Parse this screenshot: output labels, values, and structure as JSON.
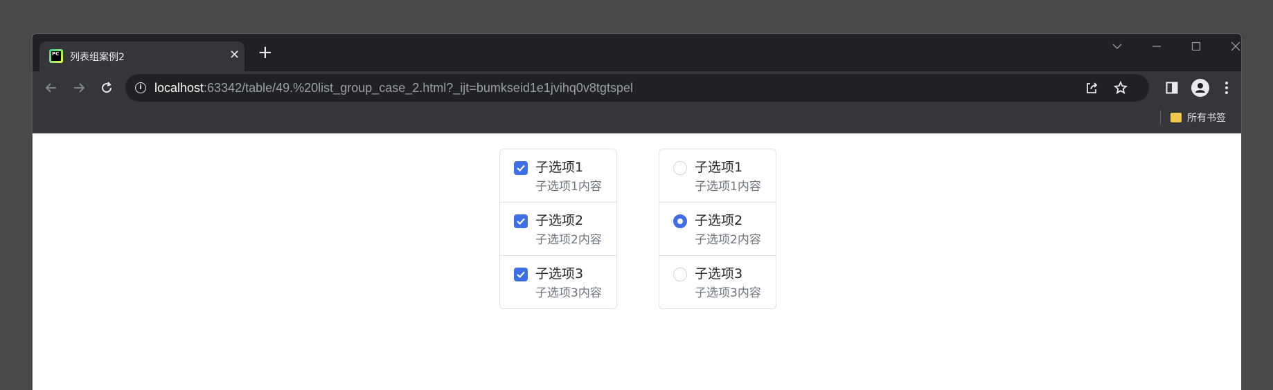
{
  "browser": {
    "tab": {
      "title": "列表组案例2",
      "favicon_text": "PC",
      "close_label": "✕"
    },
    "new_tab_label": "+",
    "url": {
      "host": "localhost",
      "rest": ":63342/table/49.%20list_group_case_2.html?_ijt=bumkseid1e1jvihq0v8tgtspel"
    },
    "bookmarks": {
      "folder_label": "所有书签"
    }
  },
  "page": {
    "checkbox_group": [
      {
        "title": "子选项1",
        "subtitle": "子选项1内容",
        "checked": true
      },
      {
        "title": "子选项2",
        "subtitle": "子选项2内容",
        "checked": true
      },
      {
        "title": "子选项3",
        "subtitle": "子选项3内容",
        "checked": true
      }
    ],
    "radio_group": [
      {
        "title": "子选项1",
        "subtitle": "子选项1内容",
        "checked": false
      },
      {
        "title": "子选项2",
        "subtitle": "子选项2内容",
        "checked": true
      },
      {
        "title": "子选项3",
        "subtitle": "子选项3内容",
        "checked": false
      }
    ]
  },
  "colors": {
    "accent": "#3e6fe6",
    "border": "#dee2e6",
    "muted_text": "#6c757d"
  }
}
